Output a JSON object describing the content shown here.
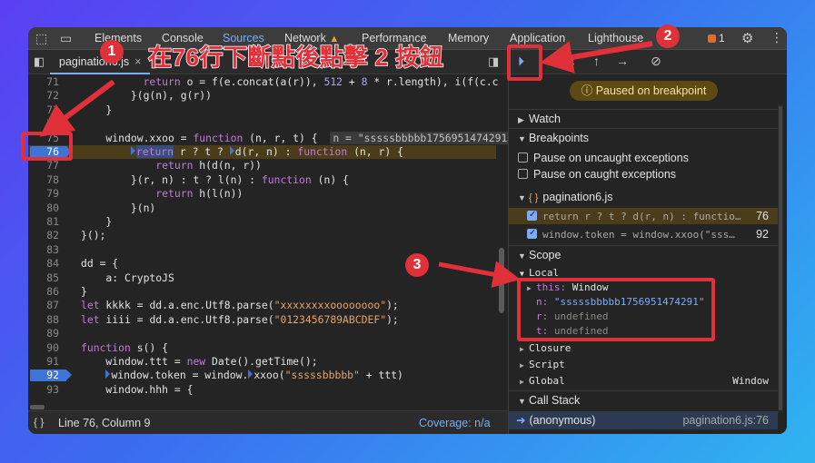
{
  "tabs": {
    "items": [
      "Elements",
      "Console",
      "Sources",
      "Network",
      "Performance",
      "Memory",
      "Application",
      "Lighthouse"
    ],
    "active": "Sources",
    "issue_count": "1"
  },
  "file_tab": {
    "name": "pagination6.js"
  },
  "code_lines": [
    {
      "n": "71",
      "t": "          return o = f(e.concat(a(r)), 512 + 8 * r.length), i(f(c.c"
    },
    {
      "n": "72",
      "t": "        }(g(n), g(r))"
    },
    {
      "n": "73",
      "t": "    }"
    },
    {
      "n": "74",
      "t": ""
    },
    {
      "n": "75",
      "t": "    window.xxoo = function (n, r, t) {"
    },
    {
      "n": "76",
      "t": "return r ? t ? d(r, n) : function (n, r) {"
    },
    {
      "n": "77",
      "t": "            return h(d(n, r))"
    },
    {
      "n": "78",
      "t": "        }(r, n) : t ? l(n) : function (n) {"
    },
    {
      "n": "79",
      "t": "            return h(l(n))"
    },
    {
      "n": "80",
      "t": "        }(n)"
    },
    {
      "n": "81",
      "t": "    }"
    },
    {
      "n": "82",
      "t": "}();"
    },
    {
      "n": "83",
      "t": ""
    },
    {
      "n": "84",
      "t": "dd = {"
    },
    {
      "n": "85",
      "t": "    a: CryptoJS"
    },
    {
      "n": "86",
      "t": "}"
    },
    {
      "n": "87",
      "t": "let kkkk = dd.a.enc.Utf8.parse(\"xxxxxxxxoooooooo\");"
    },
    {
      "n": "88",
      "t": "let iiii = dd.a.enc.Utf8.parse(\"0123456789ABCDEF\");"
    },
    {
      "n": "89",
      "t": ""
    },
    {
      "n": "90",
      "t": "function s() {"
    },
    {
      "n": "91",
      "t": "    window.ttt = new Date().getTime();"
    },
    {
      "n": "92",
      "t": "window.token = window.xxoo(\"sssssbbbbb\" + ttt)"
    },
    {
      "n": "93",
      "t": "    window.hhh = {"
    }
  ],
  "inline_value": "n = \"sssssbbbbb1756951474291\"",
  "status": {
    "position": "Line 76, Column 9",
    "coverage": "Coverage: n/a"
  },
  "debugger": {
    "paused": "Paused on breakpoint",
    "sections": {
      "watch": "Watch",
      "breakpoints": "Breakpoints",
      "scope": "Scope",
      "call_stack": "Call Stack"
    },
    "pause_uncaught": "Pause on uncaught exceptions",
    "pause_caught": "Pause on caught exceptions",
    "bp_file": "pagination6.js",
    "bp_items": [
      {
        "code": "return r ? t ? d(r, n) : functio…",
        "line": "76"
      },
      {
        "code": "window.token = window.xxoo(\"sss…",
        "line": "92"
      }
    ],
    "local_label": "Local",
    "this_key": "this:",
    "this_val": "Window",
    "n_key": "n:",
    "n_val": "\"sssssbbbbb1756951474291\"",
    "r_key": "r:",
    "r_val": "undefined",
    "t_key": "t:",
    "t_val": "undefined",
    "closure": "Closure",
    "script": "Script",
    "global": "Global",
    "global_val": "Window",
    "call_fn": "(anonymous)",
    "call_loc": "pagination6.js:76"
  },
  "annotations": {
    "banner": "在76行下斷點後點擊 2 按鈕",
    "badge1": "1",
    "badge2": "2",
    "badge3": "3",
    "accent": "#e0303a"
  },
  "icons": [
    "inspect-icon",
    "device-icon",
    "warning-icon",
    "issues-icon",
    "gear-icon",
    "kebab-icon",
    "navigator-icon",
    "resume-icon",
    "step-over-icon",
    "step-into-icon",
    "step-out-icon",
    "step-icon",
    "deactivate-breakpoints-icon",
    "curly-braces-icon",
    "info-icon"
  ]
}
